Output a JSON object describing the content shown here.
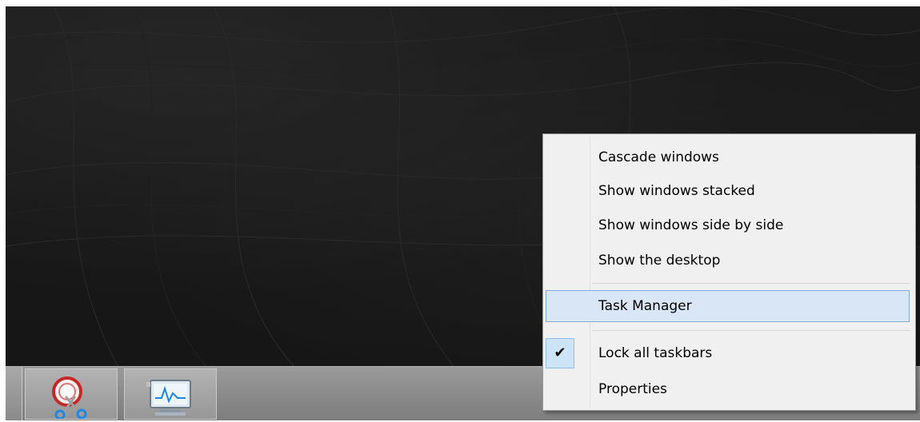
{
  "context_menu": {
    "items": [
      {
        "label": "Cascade windows"
      },
      {
        "label": "Show windows stacked"
      },
      {
        "label": "Show windows side by side"
      },
      {
        "label": "Show the desktop"
      },
      {
        "label": "Task Manager",
        "highlighted": true
      },
      {
        "label": "Lock all taskbars",
        "checked": true
      },
      {
        "label": "Properties"
      }
    ],
    "check_glyph": "✔"
  },
  "taskbar": {
    "buttons": [
      {
        "icon": "snipping-tool-icon"
      },
      {
        "icon": "performance-monitor-icon"
      }
    ]
  },
  "colors": {
    "highlight_bg": "#d9e6f5",
    "highlight_border": "#86a9d6",
    "menu_bg": "#f0f0f0",
    "desktop_bg": "#1b1b1b"
  }
}
